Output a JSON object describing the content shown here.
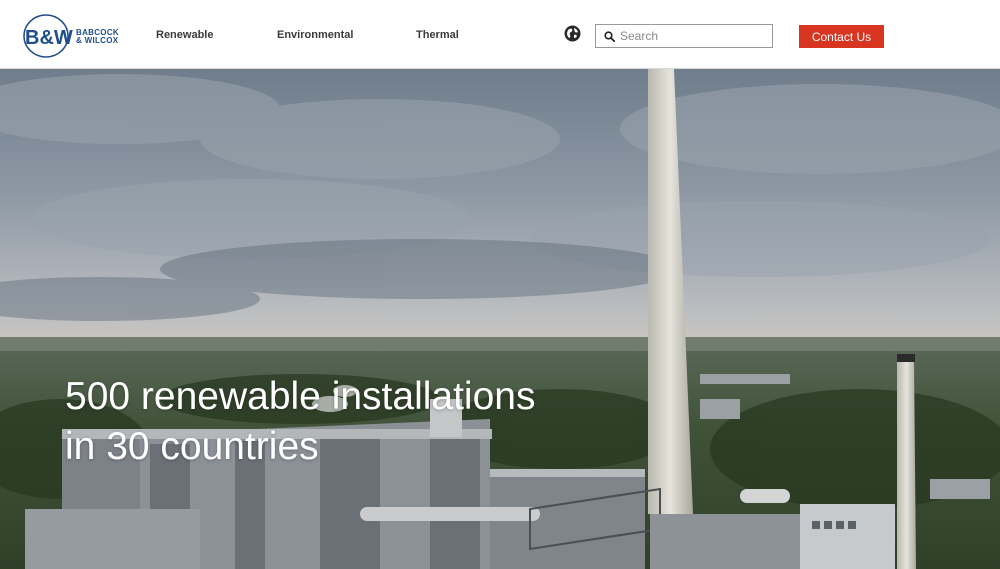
{
  "brand": {
    "logo_mark": "B&W",
    "name_line1": "BABCOCK",
    "name_line2": "& WILCOX"
  },
  "nav": {
    "items": [
      {
        "label": "Renewable"
      },
      {
        "label": "Environmental"
      },
      {
        "label": "Thermal"
      }
    ]
  },
  "header_tools": {
    "globe_icon": "globe-icon",
    "search_placeholder": "Search",
    "search_value": "",
    "contact_label": "Contact Us"
  },
  "hero": {
    "heading_line1": "500 renewable installations",
    "heading_line2": "in 30 countries"
  },
  "colors": {
    "accent_red": "#d73520",
    "brand_blue": "#1f4e8c",
    "nav_text": "#3b3b3b"
  }
}
